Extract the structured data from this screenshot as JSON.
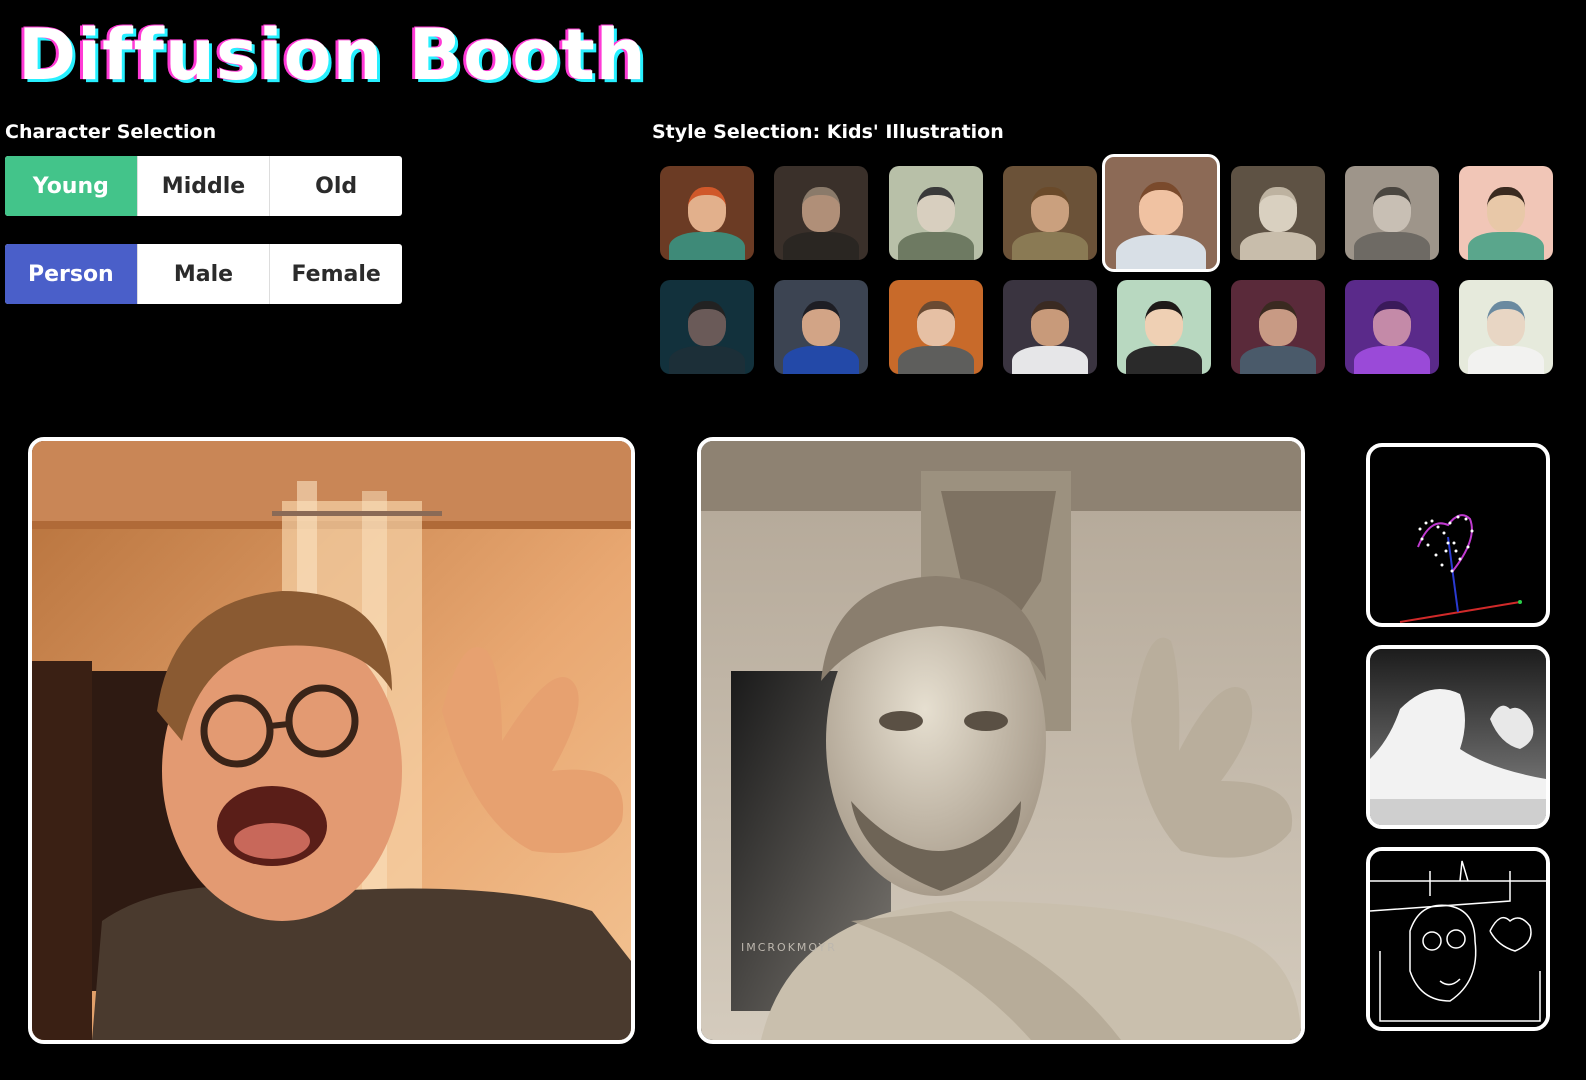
{
  "app": {
    "title": "Diffusion Booth"
  },
  "character": {
    "label": "Character Selection",
    "age_options": [
      "Young",
      "Middle",
      "Old"
    ],
    "age_selected": "Young",
    "gender_options": [
      "Person",
      "Male",
      "Female"
    ],
    "gender_selected": "Person"
  },
  "style": {
    "label": "Style Selection: Kids' Illustration",
    "selected_index": 4,
    "thumbnails": [
      {
        "name": "3d-cartoon",
        "bg": "#6b3b24",
        "face": "#e2b08c",
        "body": "#3e8a78",
        "hair": "#d0582a"
      },
      {
        "name": "dark-photo",
        "bg": "#3a302a",
        "face": "#b08f78",
        "body": "#2a2622",
        "hair": "#8a7a6a"
      },
      {
        "name": "sketch",
        "bg": "#b8c0a8",
        "face": "#d8cfbf",
        "body": "#6e7a62",
        "hair": "#3a3a3a"
      },
      {
        "name": "warm-photo",
        "bg": "#6b5238",
        "face": "#caa07e",
        "body": "#8a7a54",
        "hair": "#6a4a2a"
      },
      {
        "name": "kids-illustration",
        "bg": "#8c6a56",
        "face": "#f0c2a2",
        "body": "#d8dfe6",
        "hair": "#7a4a2c"
      },
      {
        "name": "marble-statue",
        "bg": "#5e5244",
        "face": "#d9d0c0",
        "body": "#c8bdab",
        "hair": "#bdb2a0"
      },
      {
        "name": "sepia",
        "bg": "#9e958a",
        "face": "#c8bfb4",
        "body": "#6e6a64",
        "hair": "#4a4640"
      },
      {
        "name": "pastel-flat",
        "bg": "#f1c6b7",
        "face": "#e8c8a8",
        "body": "#5aa68c",
        "hair": "#3a2a20"
      },
      {
        "name": "cyberpunk",
        "bg": "#12313c",
        "face": "#6a5a58",
        "body": "#1c2f38",
        "hair": "#222"
      },
      {
        "name": "superhero",
        "bg": "#3c4452",
        "face": "#d2a486",
        "body": "#2349a8",
        "hair": "#1e1e24"
      },
      {
        "name": "orange-light",
        "bg": "#c86a2a",
        "face": "#e6c0a4",
        "body": "#5e5e5c",
        "hair": "#6a4a32"
      },
      {
        "name": "astronaut",
        "bg": "#3a3440",
        "face": "#c89a7a",
        "body": "#e6e6e8",
        "hair": "#3a2a22"
      },
      {
        "name": "caricature",
        "bg": "#b8d8c0",
        "face": "#efd0b4",
        "body": "#2a2a2a",
        "hair": "#1e1a18"
      },
      {
        "name": "neon-room",
        "bg": "#5a2a3a",
        "face": "#c89a84",
        "body": "#4a5a6a",
        "hair": "#3a2a20"
      },
      {
        "name": "purple-light",
        "bg": "#5a2a8a",
        "face": "#c48aa8",
        "body": "#9a4ad8",
        "hair": "#3a1a5a"
      },
      {
        "name": "watercolor",
        "bg": "#e6eadc",
        "face": "#e8d6c4",
        "body": "#f2f2f0",
        "hair": "#6a8aa0"
      }
    ]
  },
  "panels": {
    "input_name": "webcam-input",
    "output_name": "generated-output",
    "output_watermark": "IMCROKMOYR"
  },
  "colors": {
    "young_active": "#43c48a",
    "person_active": "#4a5fc9",
    "background": "#000000"
  }
}
